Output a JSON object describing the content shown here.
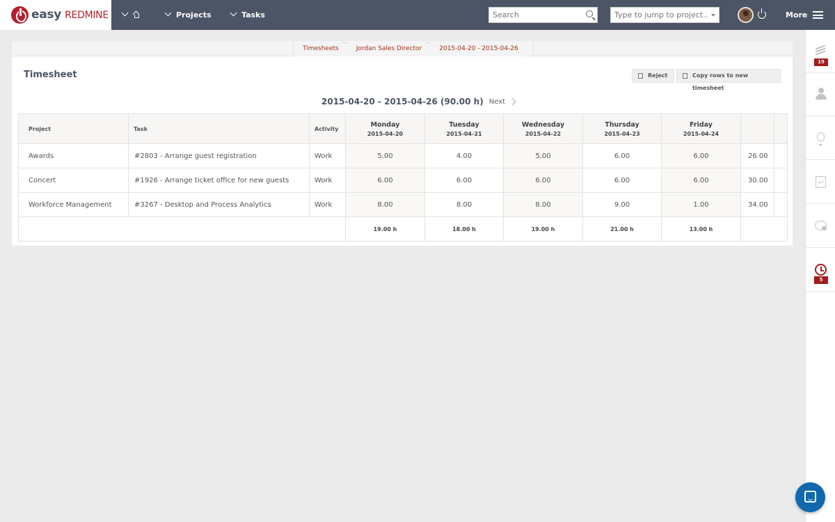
{
  "app": {
    "logo_easy": "easy",
    "logo_redmine": "REDMINE"
  },
  "nav": {
    "home_icon": "home-icon",
    "projects": "Projects",
    "tasks": "Tasks",
    "more": "More"
  },
  "search": {
    "placeholder": "Search"
  },
  "jump": {
    "placeholder": "Type to jump to project..."
  },
  "breadcrumb": [
    "Timesheets",
    "Jordan Sales Director",
    "2015-04-20 - 2015-04-26"
  ],
  "page": {
    "title": "Timesheet",
    "reject_label": "Reject",
    "copy_label": "Copy rows to new timesheet",
    "week_label": "2015-04-20 - 2015-04-26 (90.00 h)",
    "next_label": "Next"
  },
  "table": {
    "headers": {
      "project": "Project",
      "task": "Task",
      "activity": "Activity"
    },
    "days": [
      {
        "name": "Monday",
        "date": "2015-04-20"
      },
      {
        "name": "Tuesday",
        "date": "2015-04-21"
      },
      {
        "name": "Wednesday",
        "date": "2015-04-22"
      },
      {
        "name": "Thursday",
        "date": "2015-04-23"
      },
      {
        "name": "Friday",
        "date": "2015-04-24"
      }
    ],
    "rows": [
      {
        "project": "Awards",
        "task": "#2803 - Arrange guest registration",
        "activity": "Work",
        "hours": [
          "5.00",
          "4.00",
          "5.00",
          "6.00",
          "6.00"
        ],
        "total": "26.00"
      },
      {
        "project": "Concert",
        "task": "#1926 - Arrange ticket office for new guests",
        "activity": "Work",
        "hours": [
          "6.00",
          "6.00",
          "6.00",
          "6.00",
          "6.00"
        ],
        "total": "30.00"
      },
      {
        "project": "Workforce Management",
        "task": "#3267 - Desktop and Process Analytics",
        "activity": "Work",
        "hours": [
          "8.00",
          "8.00",
          "8.00",
          "9.00",
          "1.00"
        ],
        "total": "34.00"
      }
    ],
    "day_totals": [
      "19.00 h",
      "18.00 h",
      "19.00 h",
      "21.00 h",
      "13.00 h"
    ]
  },
  "sidebar": {
    "badges": {
      "stack": "19",
      "history": "5"
    }
  },
  "colors": {
    "topbar": "#4b5566",
    "brand_red": "#b6202d",
    "link": "#a03218",
    "chat": "#1268ad"
  }
}
